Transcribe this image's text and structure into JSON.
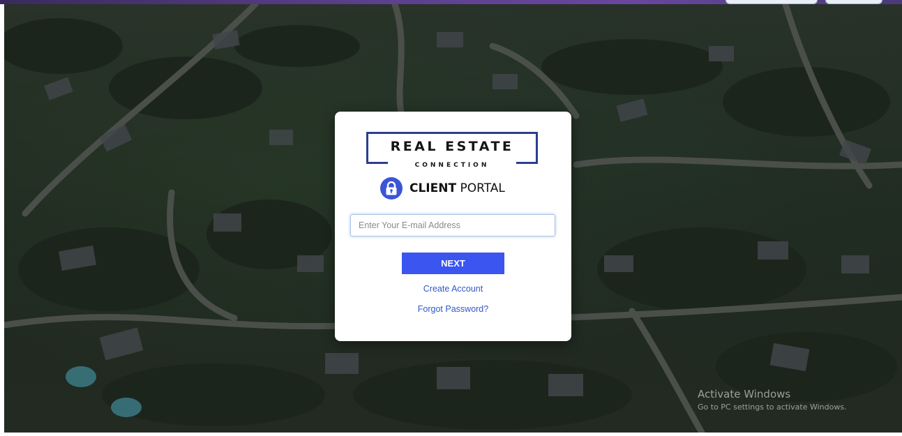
{
  "brand": {
    "logo_main": "REAL ESTATE",
    "logo_sub": "CONNECTION",
    "portal_bold": "CLIENT",
    "portal_light": " PORTAL",
    "accent": "#3b55f0",
    "navy": "#2c3e8f"
  },
  "login": {
    "email_placeholder": "Enter Your E-mail Address",
    "email_value": "",
    "next_label": "NEXT",
    "create_account": "Create Account",
    "forgot_password": "Forgot Password?"
  },
  "watermark": {
    "title": "Activate Windows",
    "subtitle": "Go to PC settings to activate Windows."
  },
  "icons": {
    "lock": "padlock-icon"
  }
}
